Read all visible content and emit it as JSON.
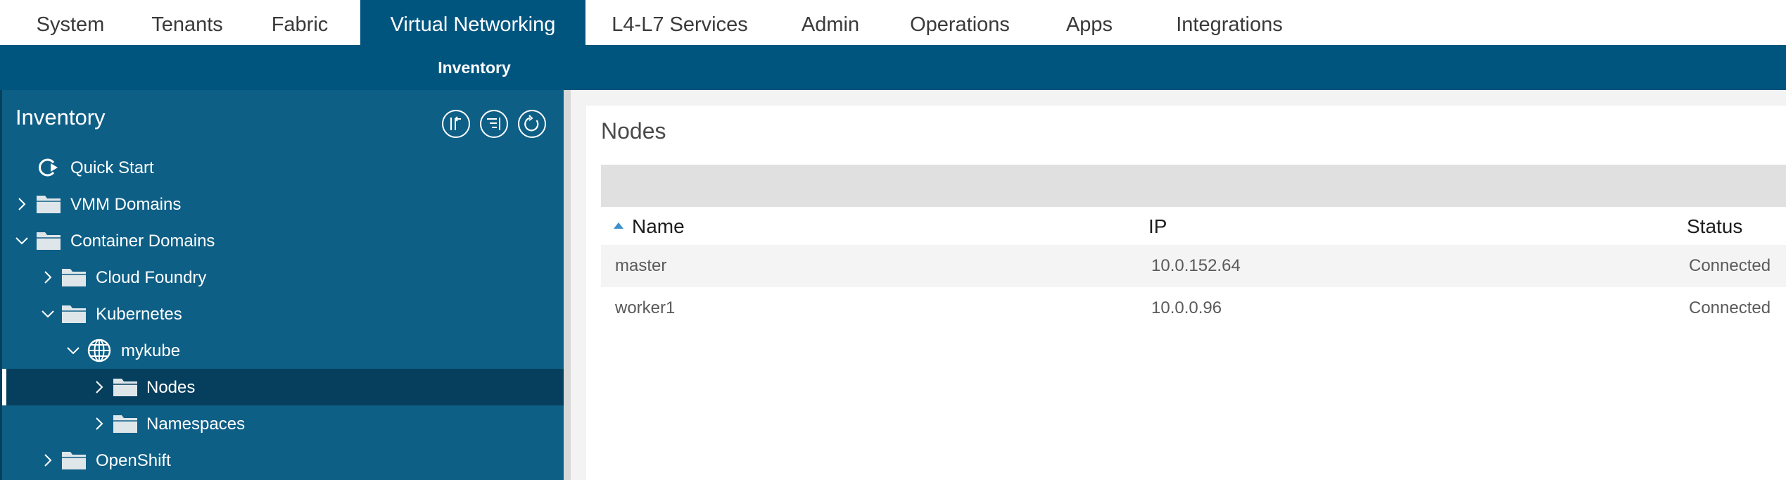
{
  "top_nav": {
    "tabs": [
      {
        "label": "System"
      },
      {
        "label": "Tenants"
      },
      {
        "label": "Fabric"
      },
      {
        "label": "Virtual Networking",
        "active": true
      },
      {
        "label": "L4-L7 Services"
      },
      {
        "label": "Admin"
      },
      {
        "label": "Operations"
      },
      {
        "label": "Apps"
      },
      {
        "label": "Integrations"
      }
    ]
  },
  "sub_nav": {
    "active_label": "Inventory"
  },
  "sidebar": {
    "title": "Inventory",
    "action_icons": [
      "collapse-tree-icon",
      "expand-tree-icon",
      "refresh-icon"
    ],
    "tree": [
      {
        "label": "Quick Start",
        "icon": "quick-start-icon",
        "level": 0,
        "chevron": "none"
      },
      {
        "label": "VMM Domains",
        "icon": "folder-icon",
        "level": 0,
        "chevron": "right"
      },
      {
        "label": "Container Domains",
        "icon": "folder-icon",
        "level": 0,
        "chevron": "down"
      },
      {
        "label": "Cloud Foundry",
        "icon": "folder-icon",
        "level": 1,
        "chevron": "right"
      },
      {
        "label": "Kubernetes",
        "icon": "folder-icon",
        "level": 1,
        "chevron": "down"
      },
      {
        "label": "mykube",
        "icon": "globe-icon",
        "level": 2,
        "chevron": "down"
      },
      {
        "label": "Nodes",
        "icon": "folder-icon",
        "level": 3,
        "chevron": "right",
        "selected": true
      },
      {
        "label": "Namespaces",
        "icon": "folder-icon",
        "level": 3,
        "chevron": "right"
      },
      {
        "label": "OpenShift",
        "icon": "folder-icon",
        "level": 1,
        "chevron": "right"
      }
    ]
  },
  "main": {
    "title": "Nodes",
    "table": {
      "columns": [
        "Name",
        "IP",
        "Status"
      ],
      "sort": {
        "column": "Name",
        "direction": "ascending"
      },
      "rows": [
        [
          "master",
          "10.0.152.64",
          "Connected"
        ],
        [
          "worker1",
          "10.0.0.96",
          "Connected"
        ]
      ]
    }
  },
  "colors": {
    "nav_blue": "#00557f",
    "sidebar_blue": "#0e5f86",
    "selected_row": "#063f5d",
    "sort_arrow": "#3d8fcc"
  }
}
